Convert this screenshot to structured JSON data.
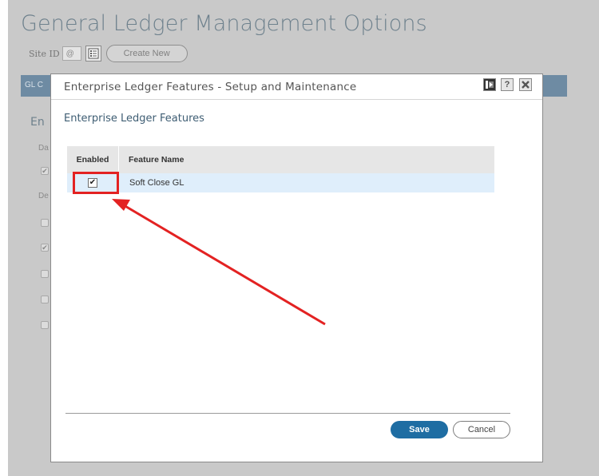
{
  "page": {
    "title": "General Ledger Management Options",
    "site_label": "Site ID",
    "site_value": "@",
    "create_label": "Create New",
    "tab_text": "GL C",
    "section_text": "En",
    "bg_labels": [
      "Da",
      "De"
    ]
  },
  "modal": {
    "title": "Enterprise Ledger Features - Setup and Maintenance",
    "help_label": "?",
    "section_title": "Enterprise Ledger Features",
    "columns": [
      "Enabled",
      "Feature Name"
    ],
    "rows": [
      {
        "enabled": "✔",
        "feature": "Soft Close GL"
      }
    ],
    "save_label": "Save",
    "cancel_label": "Cancel"
  },
  "colors": {
    "accent": "#1e6da3",
    "highlight": "#e32222",
    "tab_bar": "#6e8ba3",
    "row_selected": "#dfeefb"
  },
  "icons": [
    "list-icon",
    "layout-icon",
    "help-icon",
    "close-icon",
    "checkbox-icon",
    "arrow-annotation"
  ]
}
